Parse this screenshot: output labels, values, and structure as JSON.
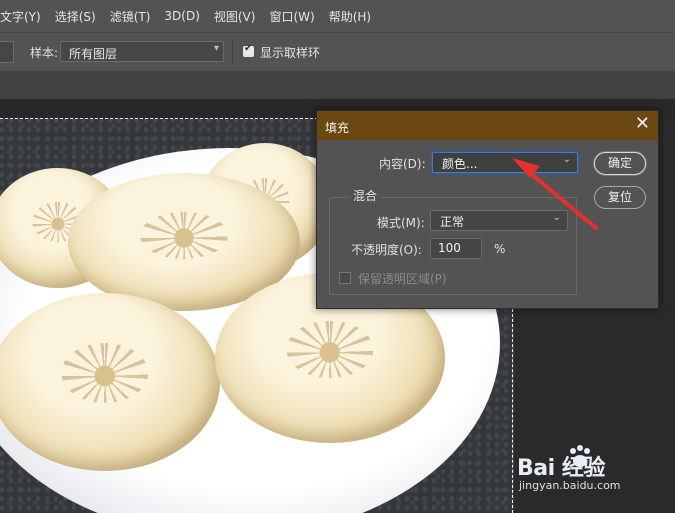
{
  "menu": [
    "文字(Y)",
    "选择(S)",
    "滤镜(T)",
    "3D(D)",
    "视图(V)",
    "窗口(W)",
    "帮助(H)"
  ],
  "options_bar": {
    "sample_label": "样本:",
    "sample_value": "所有图层",
    "show_ring_label": "显示取样环",
    "show_ring_checked": true
  },
  "dialog": {
    "title": "填充",
    "close_glyph": "✕",
    "content_label": "内容(D):",
    "content_value": "颜色...",
    "blend_group": "混合",
    "mode_label": "模式(M):",
    "mode_value": "正常",
    "opacity_label": "不透明度(O):",
    "opacity_value": "100",
    "opacity_unit": "%",
    "preserve_label": "保留透明区域(P)",
    "ok_label": "确定",
    "reset_label": "复位",
    "accent_title_color": "#6b4811"
  },
  "annotation": {
    "arrow_color": "#e8302a",
    "icon": "red-arrow"
  },
  "watermark": {
    "logo_text": "Bai  经验",
    "url": "jingyan.baidu.com"
  }
}
